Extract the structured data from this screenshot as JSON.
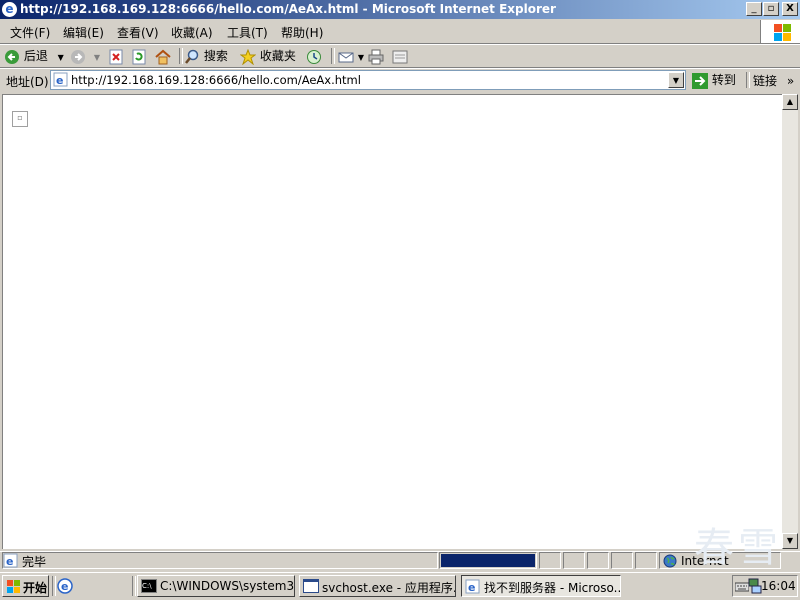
{
  "window": {
    "title": "http://192.168.169.128:6666/hello.com/AeAx.html - Microsoft Internet Explorer",
    "min_label": "_",
    "max_label": "▫",
    "close_label": "X"
  },
  "menu": {
    "items": [
      {
        "label": "文件(F)"
      },
      {
        "label": "编辑(E)"
      },
      {
        "label": "查看(V)"
      },
      {
        "label": "收藏(A)"
      },
      {
        "label": "工具(T)"
      },
      {
        "label": "帮助(H)"
      }
    ]
  },
  "toolbar": {
    "back_label": "后退",
    "search_label": "搜索",
    "favorites_label": "收藏夹"
  },
  "address": {
    "label": "地址(D)",
    "value": "http://192.168.169.128:6666/hello.com/AeAx.html",
    "go_label": "转到",
    "links_label": "链接"
  },
  "status": {
    "text": "完毕",
    "zone": "Internet",
    "progress": 1.0
  },
  "taskbar": {
    "start_label": "开始",
    "tasks": [
      {
        "label": "C:\\WINDOWS\\system32..."
      },
      {
        "label": "svchost.exe - 应用程序..."
      },
      {
        "label": "找不到服务器 - Microso..."
      }
    ],
    "clock": "16:04"
  },
  "watermark": {
    "text": "春雪"
  },
  "colors": {
    "title_active": "#0a246a",
    "face": "#d4d0c8",
    "progress": "#0a246a"
  }
}
